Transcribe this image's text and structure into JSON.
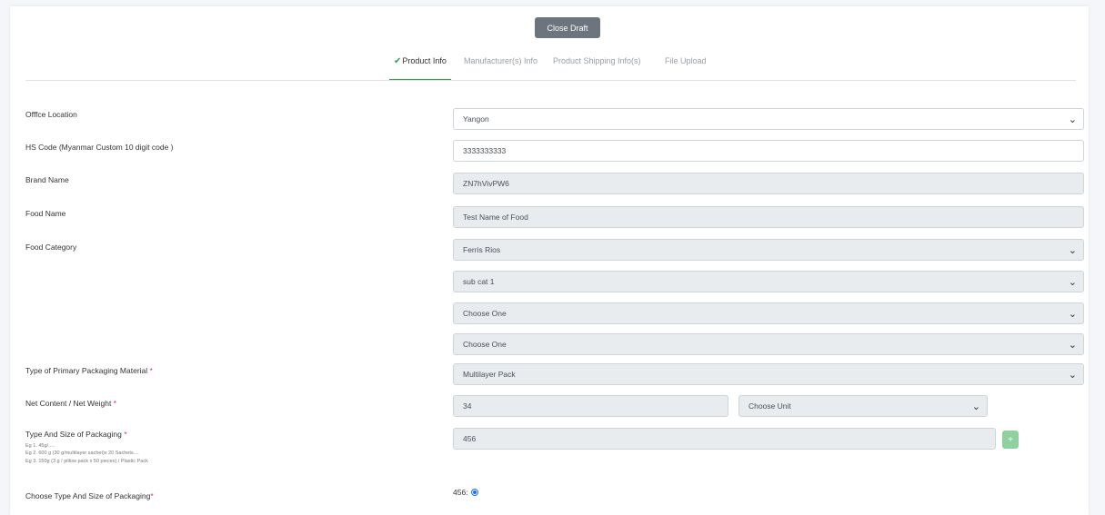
{
  "header": {
    "close_draft_label": "Close Draft"
  },
  "tabs": [
    {
      "label": "Product Info",
      "active": true
    },
    {
      "label": "Manufacturer(s) Info",
      "active": false
    },
    {
      "label": "Product Shipping Info(s)",
      "active": false
    },
    {
      "label": "File Upload",
      "active": false
    }
  ],
  "form": {
    "office_location": {
      "label": "Offfce Location",
      "value": "Yangon"
    },
    "hs_code": {
      "label": "HS Code (Myanmar Custom 10 digit code )",
      "value": "3333333333"
    },
    "brand_name": {
      "label": "Brand Name",
      "value": "ZN7hVivPW6"
    },
    "food_name": {
      "label": "Food Name",
      "value": "Test Name of Food"
    },
    "food_category": {
      "label": "Food Category",
      "values": [
        "Ferris Rios",
        "sub cat 1",
        "Choose One",
        "Choose One"
      ]
    },
    "packaging_material": {
      "label": "Type of Primary Packaging Material",
      "required_mark": "*",
      "value": "Multilayer Pack"
    },
    "net_content": {
      "label": "Net Content / Net Weight",
      "required_mark": "*",
      "value": "34",
      "unit": "Choose Unit"
    },
    "type_size_packaging": {
      "label": "Type And Size of Packaging",
      "required_mark": "*",
      "value": "456",
      "hints": [
        "Eg 1. 45g/.....",
        "Eg 2. 600 g (30 g/multilayer sachet)x 20 Sachets....",
        "Eg 3. 150g (3 g / pillow pack x 50 pieces) / Plastic Pack"
      ],
      "add_label": "+"
    },
    "choose_type_size": {
      "label": "Choose Type And Size of Packaging",
      "required_mark": "*",
      "option": "456:"
    }
  },
  "colors": {
    "accent_green": "#28a745",
    "required_red": "#dc3545",
    "radio_blue": "#1a73e8",
    "button_gray": "#6c757d"
  },
  "icons": {
    "chevron": "chevron-down-icon",
    "check": "check-icon"
  }
}
